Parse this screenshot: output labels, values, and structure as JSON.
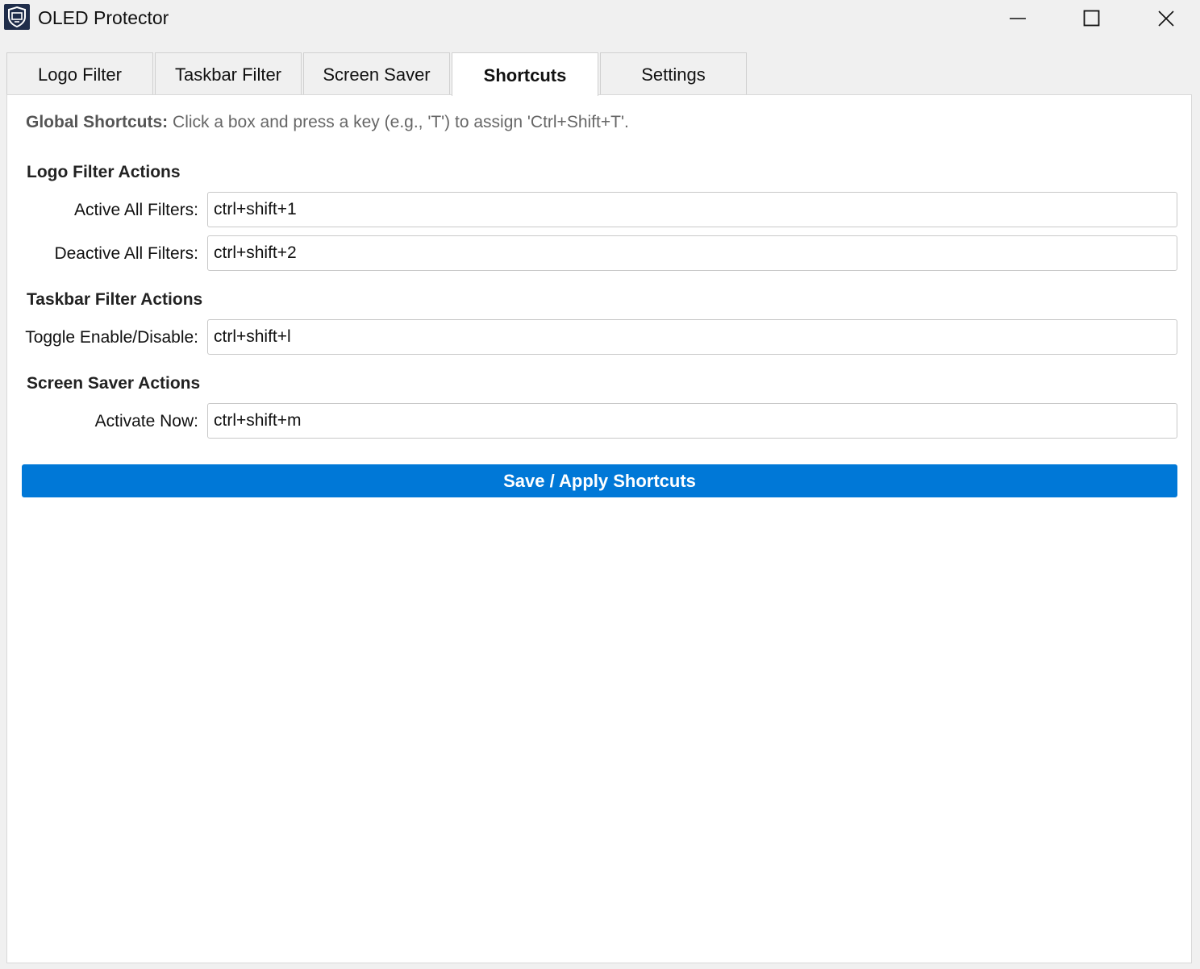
{
  "window": {
    "title": "OLED Protector"
  },
  "tabs": [
    {
      "label": "Logo Filter"
    },
    {
      "label": "Taskbar Filter"
    },
    {
      "label": "Screen Saver"
    },
    {
      "label": "Shortcuts"
    },
    {
      "label": "Settings"
    }
  ],
  "hint": {
    "bold": "Global Shortcuts:",
    "text": " Click a box and press a key (e.g., 'T') to assign 'Ctrl+Shift+T'."
  },
  "sections": {
    "logo": {
      "title": "Logo Filter Actions",
      "active_label": "Active All Filters:",
      "active_value": "ctrl+shift+1",
      "deactive_label": "Deactive All Filters:",
      "deactive_value": "ctrl+shift+2"
    },
    "taskbar": {
      "title": "Taskbar Filter Actions",
      "toggle_label": "Toggle Enable/Disable:",
      "toggle_value": "ctrl+shift+l"
    },
    "saver": {
      "title": "Screen Saver Actions",
      "activate_label": "Activate Now:",
      "activate_value": "ctrl+shift+m"
    }
  },
  "save_label": "Save / Apply Shortcuts",
  "colors": {
    "accent": "#0078d7"
  }
}
